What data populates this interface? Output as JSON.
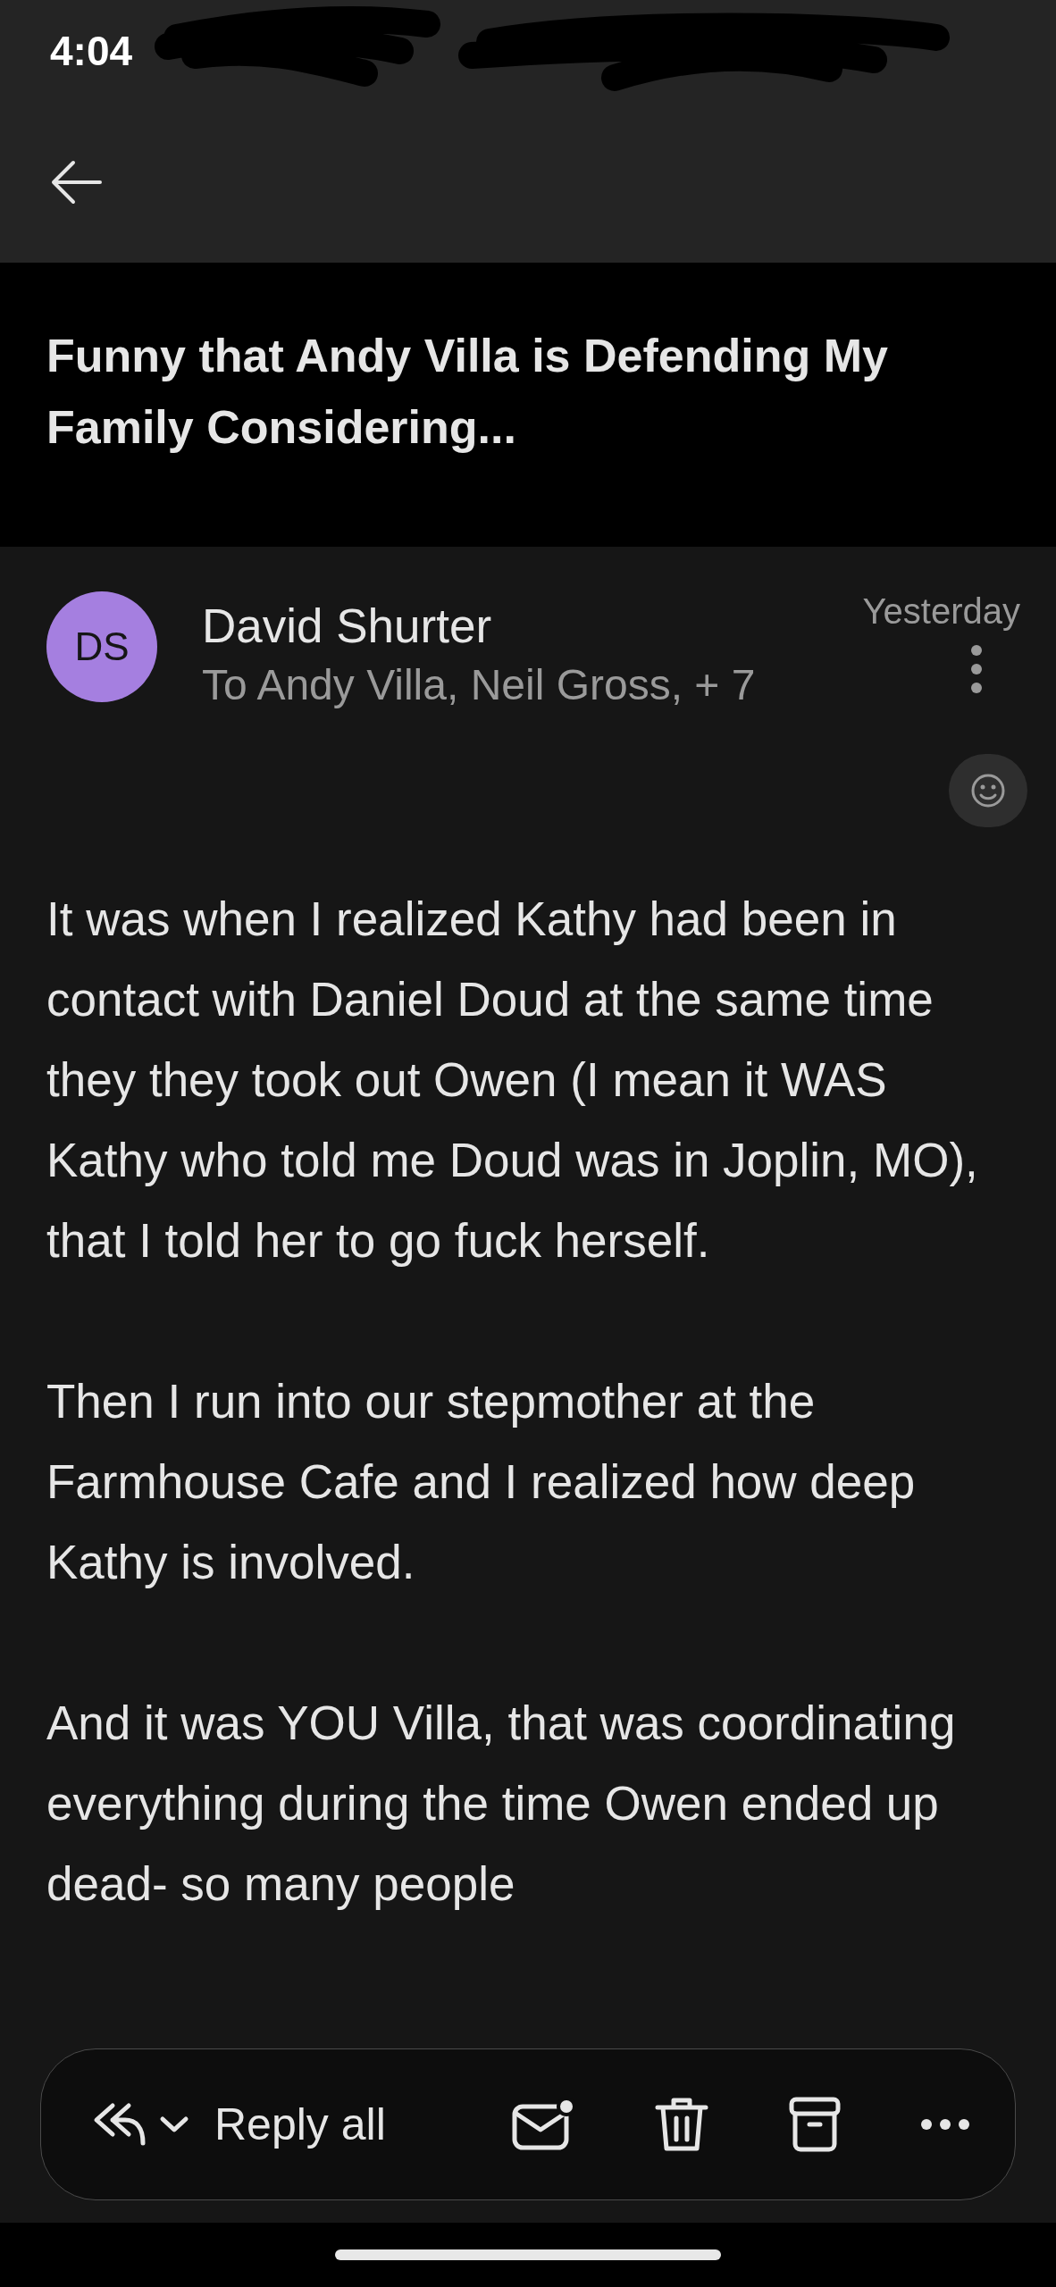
{
  "status_bar": {
    "time": "4:04"
  },
  "subject": "Funny that Andy Villa is Defending My Family Considering...",
  "message": {
    "avatar_initials": "DS",
    "sender": "David Shurter",
    "recipients": "To Andy Villa, Neil Gross, + 7",
    "date": "Yesterday",
    "paragraphs": [
      "It was when I realized Kathy had been in contact with Daniel Doud at the same time they they took out Owen (I mean it WAS Kathy who told me Doud was in Joplin, MO), that I told her to go fuck herself.",
      "Then I run into our stepmother at the Farmhouse Cafe and I realized how deep Kathy is involved.",
      "And it was YOU Villa, that was coordinating everything during the time Owen ended up dead- so many people"
    ]
  },
  "toolbar": {
    "reply_label": "Reply all",
    "unread_dot": true
  }
}
